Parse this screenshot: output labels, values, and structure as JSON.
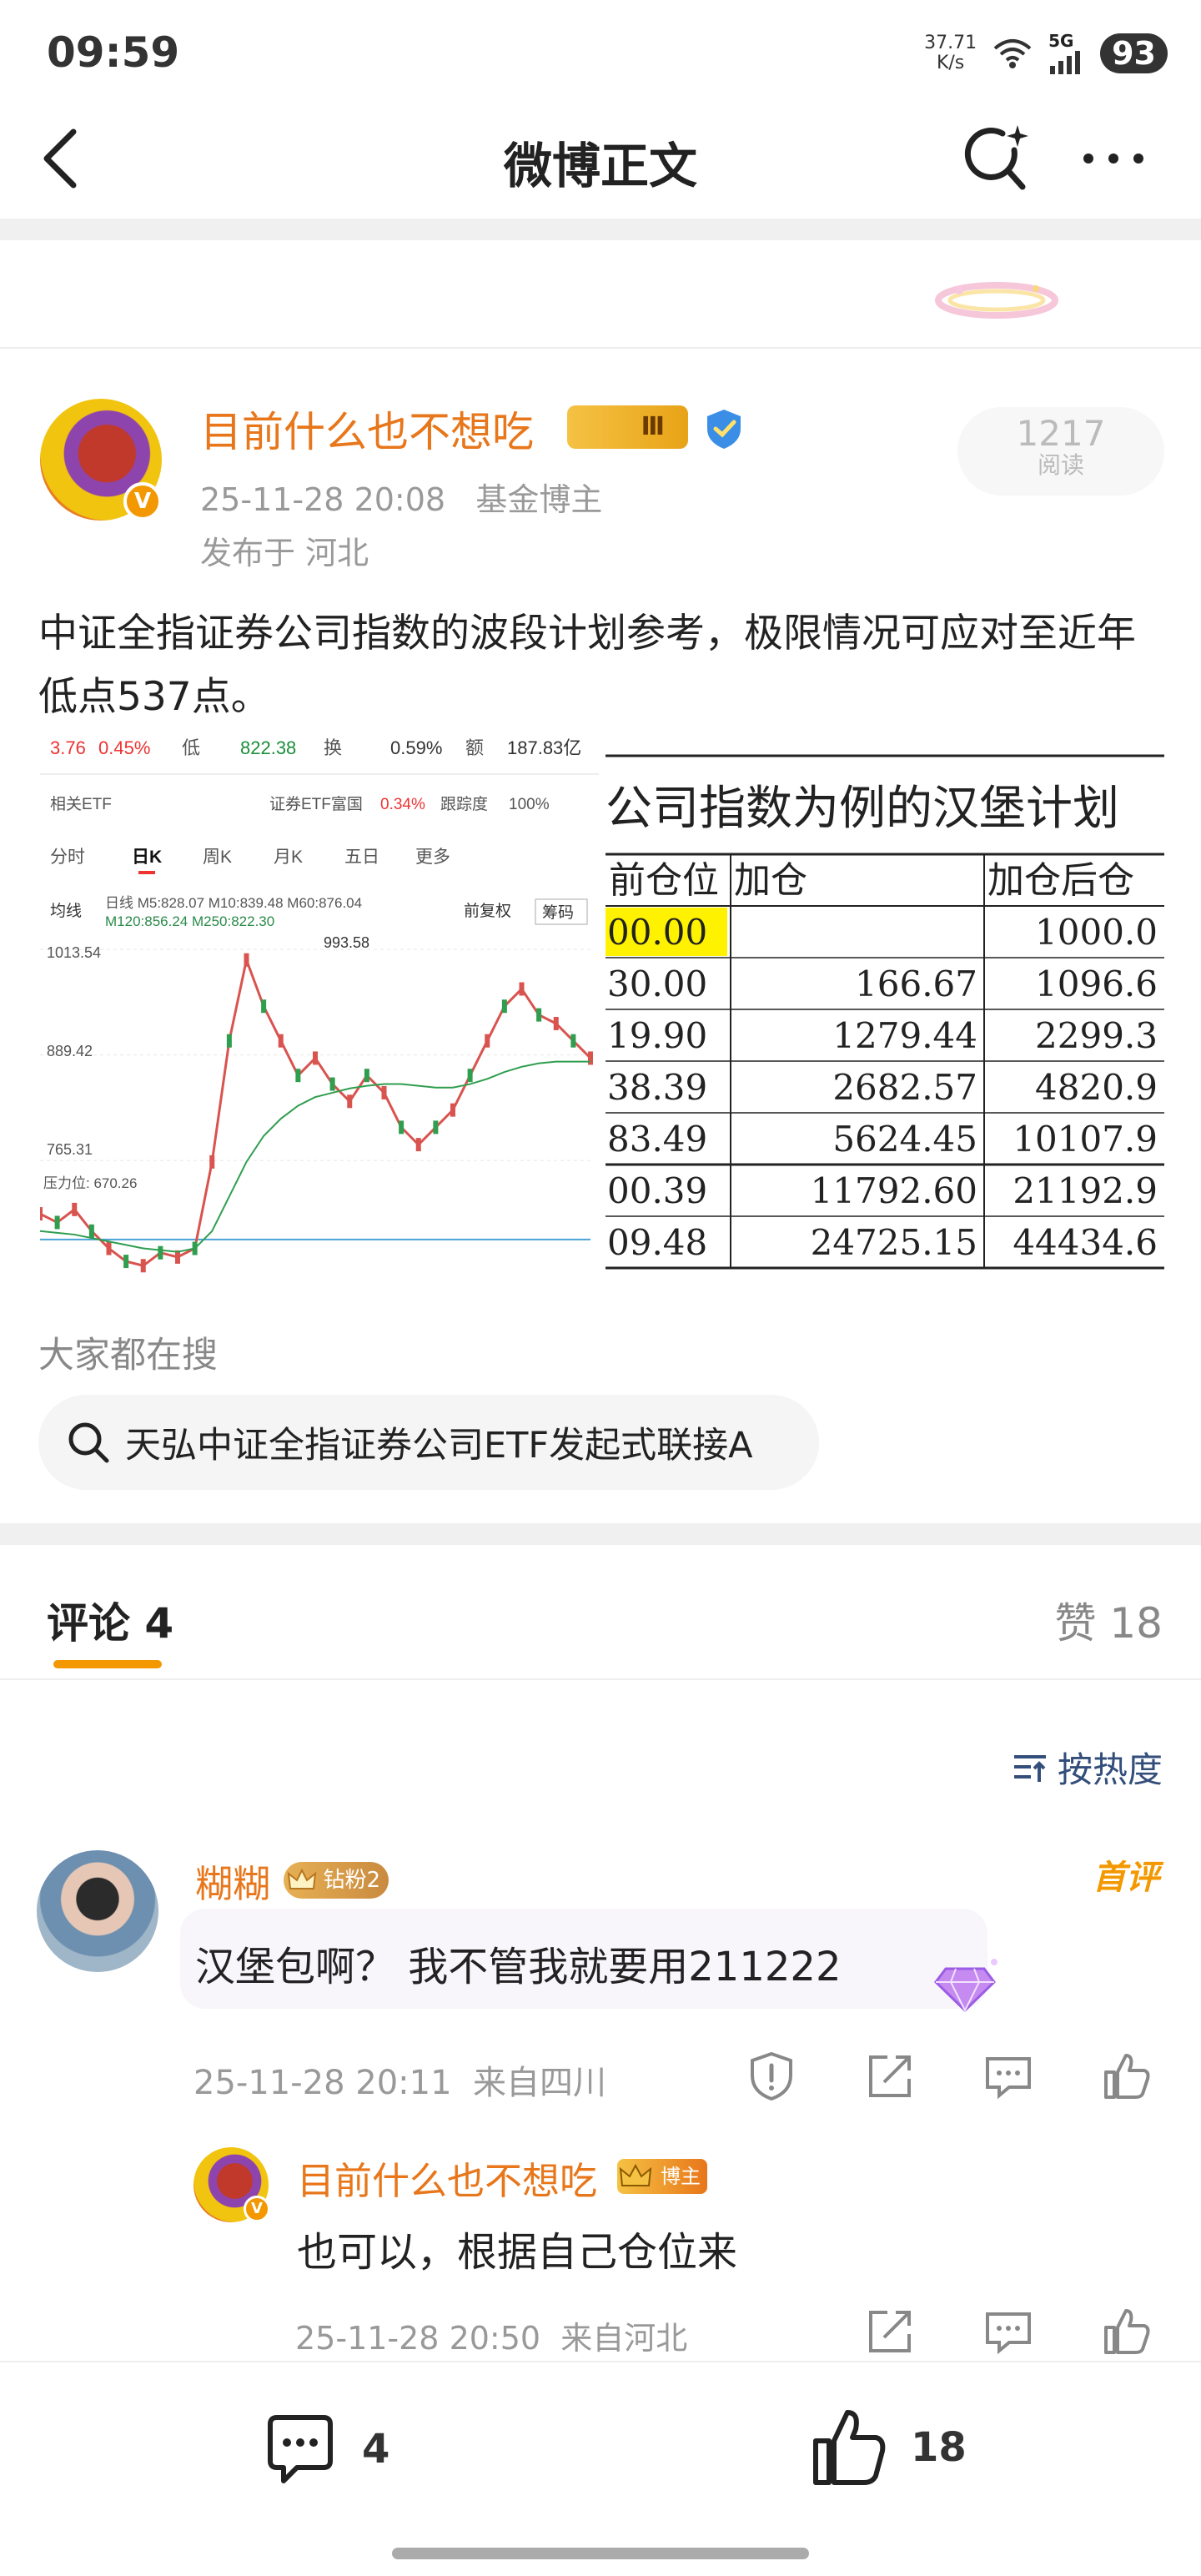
{
  "status_bar": {
    "time": "09:59",
    "net_speed_value": "37.71",
    "net_speed_unit": "K/s",
    "network": "5G",
    "battery": "93"
  },
  "nav": {
    "title": "微博正文",
    "back_icon": "chevron-left-icon",
    "search_icon": "search-sparkle-icon",
    "more_icon": "more-dots-icon"
  },
  "post": {
    "author": "目前什么也不想吃",
    "vip_badge": "Ⅲ",
    "verified_badge": "V",
    "timestamp": "25-11-28 20:08",
    "source": "基金博主",
    "location": "发布于 河北",
    "read_count": "1217",
    "read_label": "阅读",
    "text": "中证全指证券公司指数的波段计划参考，极限情况可应对至近年低点537点。"
  },
  "left_image": {
    "quote_price": "3.76",
    "quote_change": "0.45%",
    "low_label": "低",
    "low_value": "822.38",
    "turnover_label": "换",
    "turnover_value": "0.59%",
    "amount_label": "额",
    "amount_value": "187.83亿",
    "etf_label": "相关ETF",
    "etf_name": "证券ETF富国",
    "etf_change": "0.34%",
    "tracking_label": "跟踪度",
    "tracking_value": "100%",
    "tabs": [
      "分时",
      "日K",
      "周K",
      "月K",
      "五日",
      "更多"
    ],
    "active_tab": "日K",
    "ma_selector": "均线",
    "ma_line1": "日线  M5:828.07  M10:839.48  M60:876.04",
    "ma_line2": "M120:856.24  M250:822.30",
    "adjust_label": "前复权",
    "chips_label": "筹码",
    "peak_label": "993.58",
    "y_ticks": [
      "1013.54",
      "889.42",
      "765.31"
    ],
    "pressure_label": "压力位: 670.26",
    "chart_data": {
      "type": "line",
      "title": "",
      "xlabel": "",
      "ylabel": "",
      "ylim": [
        620,
        1013.54
      ],
      "series": [
        {
          "name": "日线",
          "values": [
            700,
            690,
            705,
            680,
            660,
            645,
            640,
            655,
            650,
            660,
            760,
            900,
            993.58,
            940,
            900,
            860,
            880,
            850,
            830,
            860,
            840,
            800,
            780,
            800,
            820,
            860,
            900,
            940,
            960,
            930,
            920,
            900,
            880
          ]
        },
        {
          "name": "M60",
          "values": [
            680,
            678,
            676,
            672,
            668,
            664,
            660,
            658,
            656,
            660,
            680,
            720,
            760,
            790,
            810,
            825,
            835,
            840,
            845,
            848,
            850,
            850,
            848,
            846,
            846,
            850,
            856,
            864,
            870,
            874,
            876,
            876,
            876
          ]
        }
      ]
    }
  },
  "right_image": {
    "title": "公司指数为例的汉堡计划",
    "columns": [
      "前仓位",
      "加仓",
      "加仓后仓"
    ],
    "rows": [
      [
        "00.00",
        "",
        "1000.0"
      ],
      [
        "30.00",
        "166.67",
        "1096.6"
      ],
      [
        "19.90",
        "1279.44",
        "2299.3"
      ],
      [
        "38.39",
        "2682.57",
        "4820.9"
      ],
      [
        "83.49",
        "5624.45",
        "10107.9"
      ],
      [
        "00.39",
        "11792.60",
        "21192.9"
      ],
      [
        "09.48",
        "24725.15",
        "44434.6"
      ]
    ]
  },
  "hot_search": {
    "label": "大家都在搜",
    "query": "天弘中证全指证券公司ETF发起式联接A"
  },
  "tabs": {
    "comments": "评论 4",
    "likes": "赞 18"
  },
  "sort": {
    "label": "按热度"
  },
  "comment1": {
    "name": "糊糊",
    "badge": "钻粉2",
    "first_tag": "首评",
    "text": "汉堡包啊？ 我不管我就要用211222",
    "timestamp": "25-11-28 20:11",
    "location": "来自四川"
  },
  "reply1": {
    "name": "目前什么也不想吃",
    "badge": "博主",
    "text": "也可以，根据自己仓位来",
    "timestamp": "25-11-28 20:50",
    "location": "来自河北"
  },
  "bottom_bar": {
    "comment_count": "4",
    "like_count": "18"
  },
  "colors": {
    "accent": "#f39800",
    "author": "#e8761a",
    "muted": "#999999",
    "link_blue": "#334e7a"
  }
}
